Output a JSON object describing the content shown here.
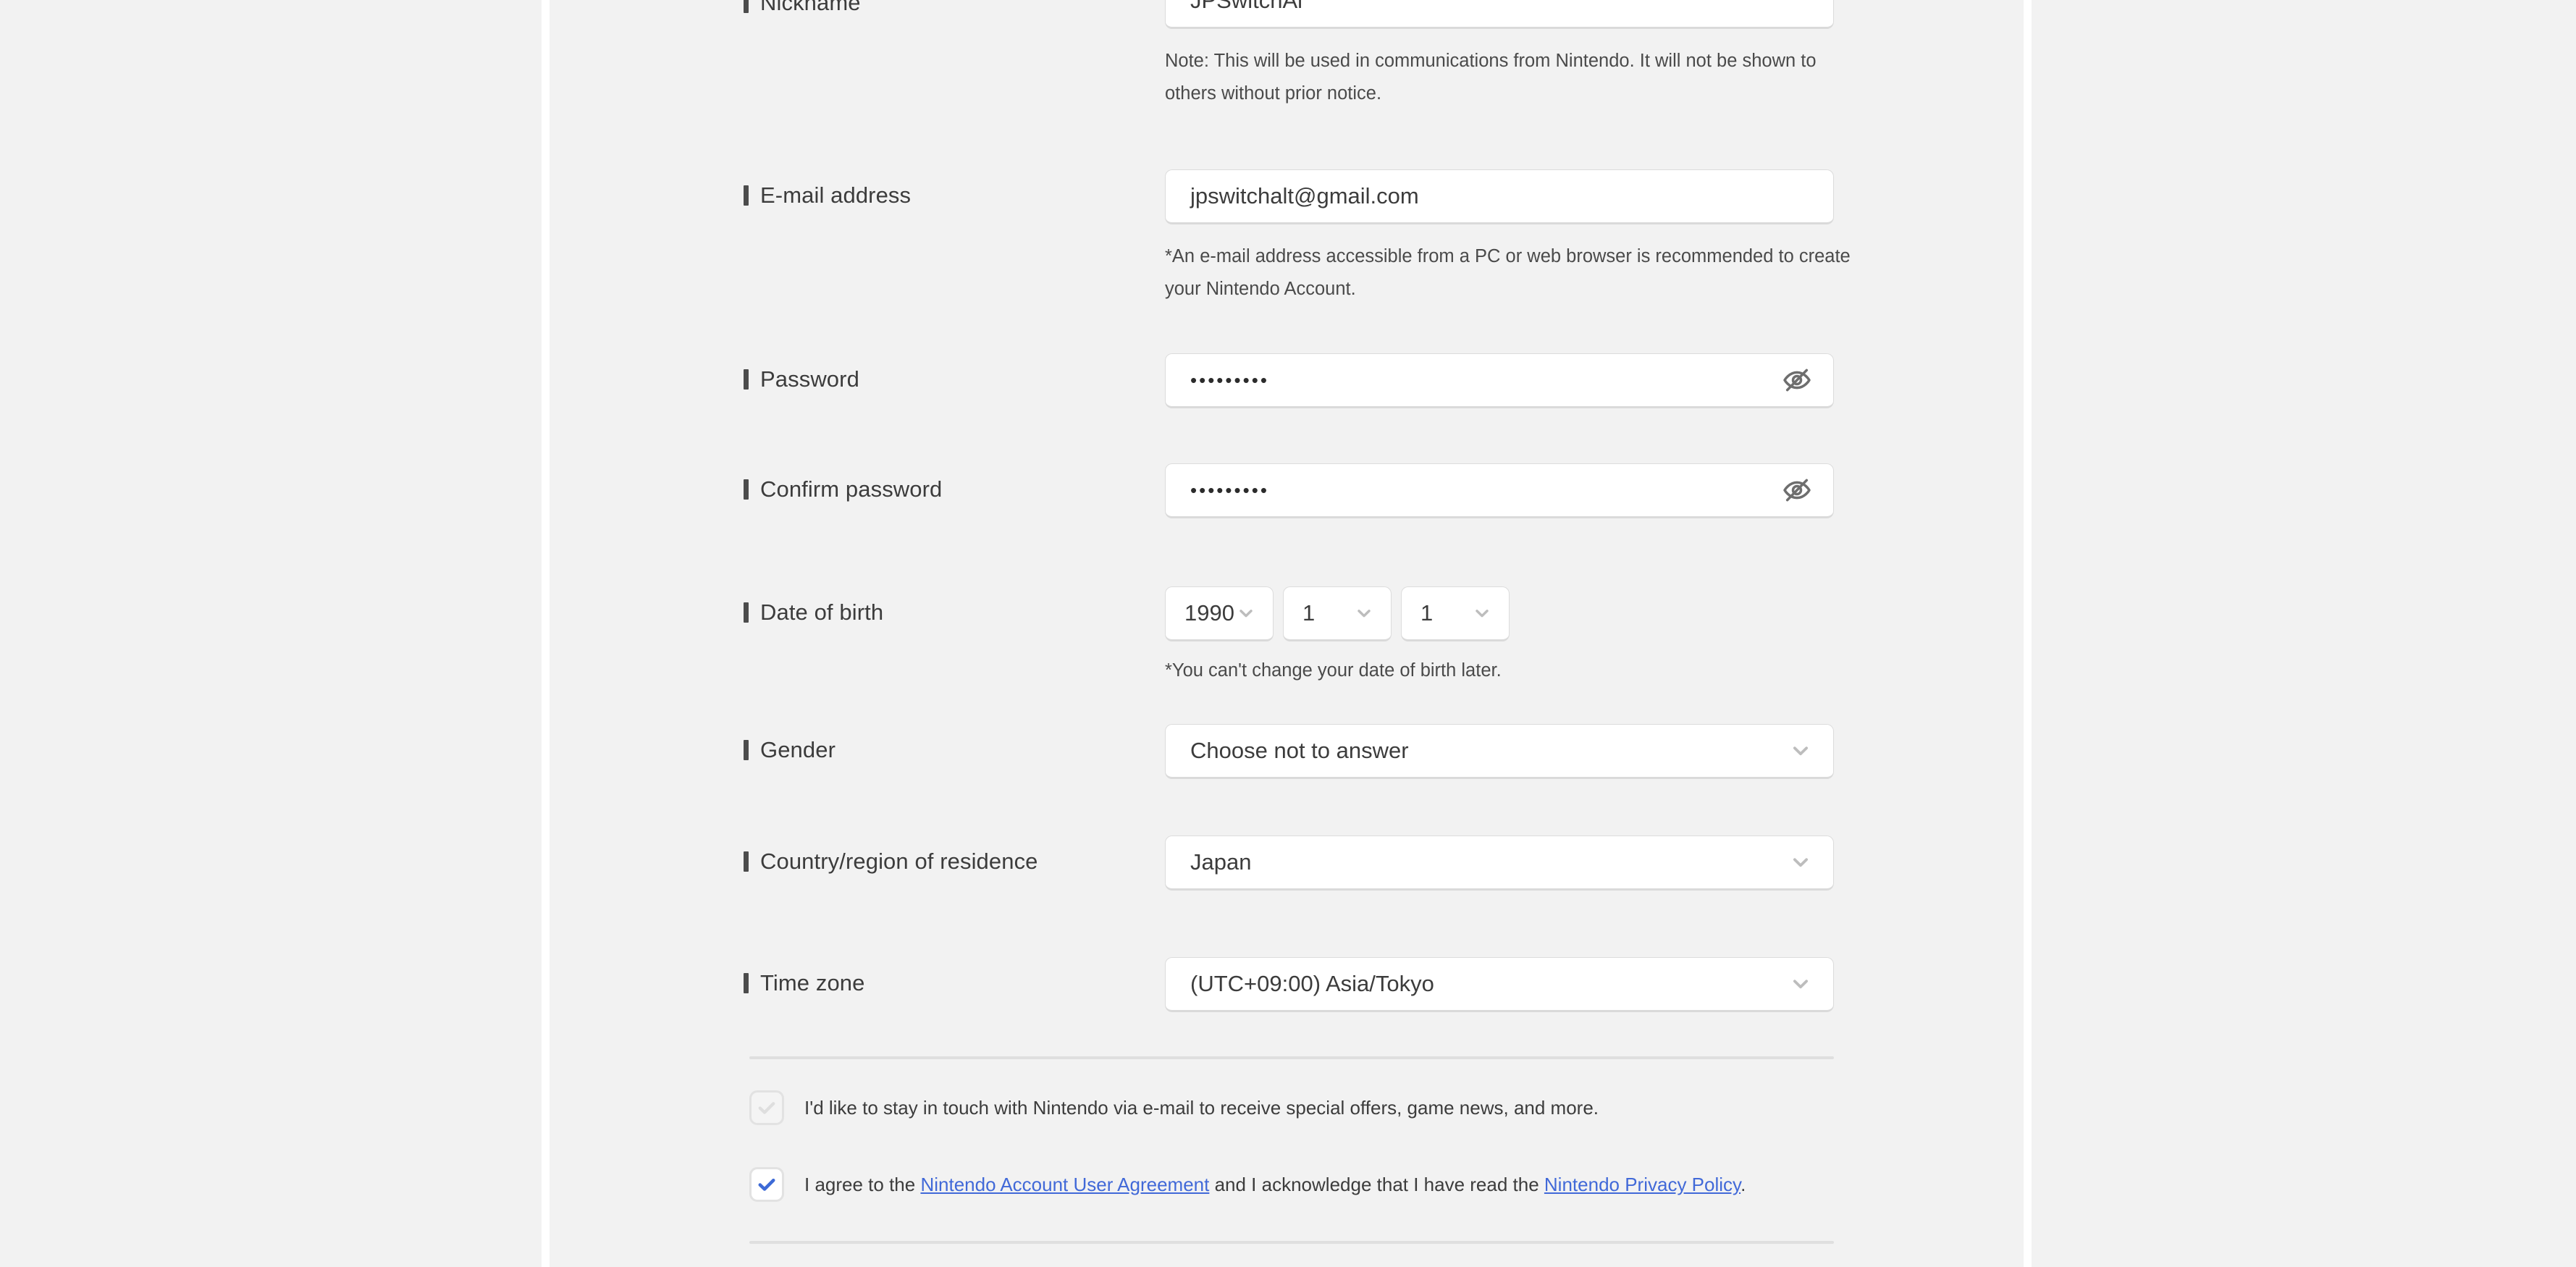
{
  "colors": {
    "page_bg": "#f2f2f2",
    "field_bg": "#ffffff",
    "field_border": "#dcdcdc",
    "text": "#3c3c3c",
    "required_bar": "#4c4c4c",
    "link": "#4169d8",
    "checkbox_checked": "#3d6ad6",
    "checkbox_unchecked": "#dedede",
    "divider": "#dfdfdf"
  },
  "form": {
    "nickname": {
      "label": "Nickname",
      "value": "JPSwitchAl",
      "note": "Note: This will be used in communications from Nintendo. It will not be shown to others without prior notice."
    },
    "email": {
      "label": "E-mail address",
      "value": "jpswitchalt@gmail.com",
      "note": "*An e-mail address accessible from a PC or web browser is recommended to create your Nintendo Account."
    },
    "password": {
      "label": "Password",
      "value": "•••••••••",
      "toggle_icon": "eye-off-icon"
    },
    "confirm_password": {
      "label": "Confirm password",
      "value": "•••••••••",
      "toggle_icon": "eye-off-icon"
    },
    "date_of_birth": {
      "label": "Date of birth",
      "year": "1990",
      "month": "1",
      "day": "1",
      "note": "*You can't change your date of birth later."
    },
    "gender": {
      "label": "Gender",
      "value": "Choose not to answer"
    },
    "country": {
      "label": "Country/region of residence",
      "value": "Japan"
    },
    "timezone": {
      "label": "Time zone",
      "value": "(UTC+09:00) Asia/Tokyo"
    }
  },
  "consents": {
    "newsletter": {
      "checked": false,
      "text": "I'd like to stay in touch with Nintendo via e-mail to receive special offers, game news, and more."
    },
    "agreement": {
      "checked": true,
      "text_before": "I agree to the ",
      "link_1": "Nintendo Account User Agreement",
      "text_middle": " and I acknowledge that I have read the ",
      "link_2": "Nintendo Privacy Policy",
      "text_after": "."
    }
  }
}
